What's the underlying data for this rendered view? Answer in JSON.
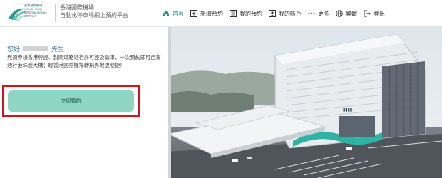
{
  "brand": {
    "logo_text": "香港 國際機場 HONG KONG INTERNATIONAL AIRPORT",
    "title": "香港國際機場",
    "subtitle": "自動化停車場網上預約平台"
  },
  "nav": {
    "home": "首頁",
    "new_booking": "新增預約",
    "my_bookings": "我的預約",
    "my_account": "我的帳戶",
    "more": "更多",
    "language": "繁體",
    "logout": "登出"
  },
  "left": {
    "greeting_prefix": "您好",
    "greeting_suffix": "先生",
    "description": "無須申領香港牌證、封閉道路通行許可證及驗車，一次預約即可自駕通行港珠澳大橋；經香港國際機場轉飛外地更便捷！",
    "cta_label": "立即預約"
  },
  "colors": {
    "accent": "#2a8f86",
    "cta": "#8ed6c3",
    "highlight": "#d4141b",
    "greeting": "#2b7fa8"
  },
  "icons": [
    "home-icon",
    "plus-icon",
    "list-icon",
    "account-icon",
    "more-icon",
    "globe-icon",
    "logout-icon"
  ]
}
